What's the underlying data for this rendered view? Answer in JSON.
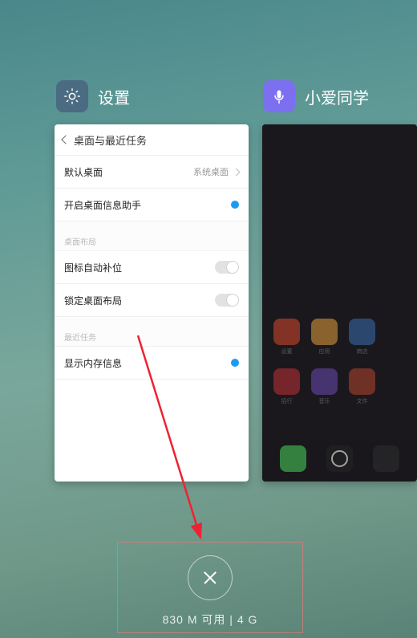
{
  "apps": {
    "settings_label": "设置",
    "xiaoai_label": "小爱同学"
  },
  "settings_page": {
    "header": "桌面与最近任务",
    "rows": {
      "default_desktop": {
        "label": "默认桌面",
        "value": "系统桌面"
      },
      "desktop_info_assistant": {
        "label": "开启桌面信息助手"
      },
      "section_layout": "桌面布局",
      "icon_auto_fill": {
        "label": "图标自动补位"
      },
      "lock_layout": {
        "label": "锁定桌面布局"
      },
      "section_recent": "最近任务",
      "show_memory_info": {
        "label": "显示内存信息"
      }
    }
  },
  "memory_text": "830 M 可用 | 4 G"
}
